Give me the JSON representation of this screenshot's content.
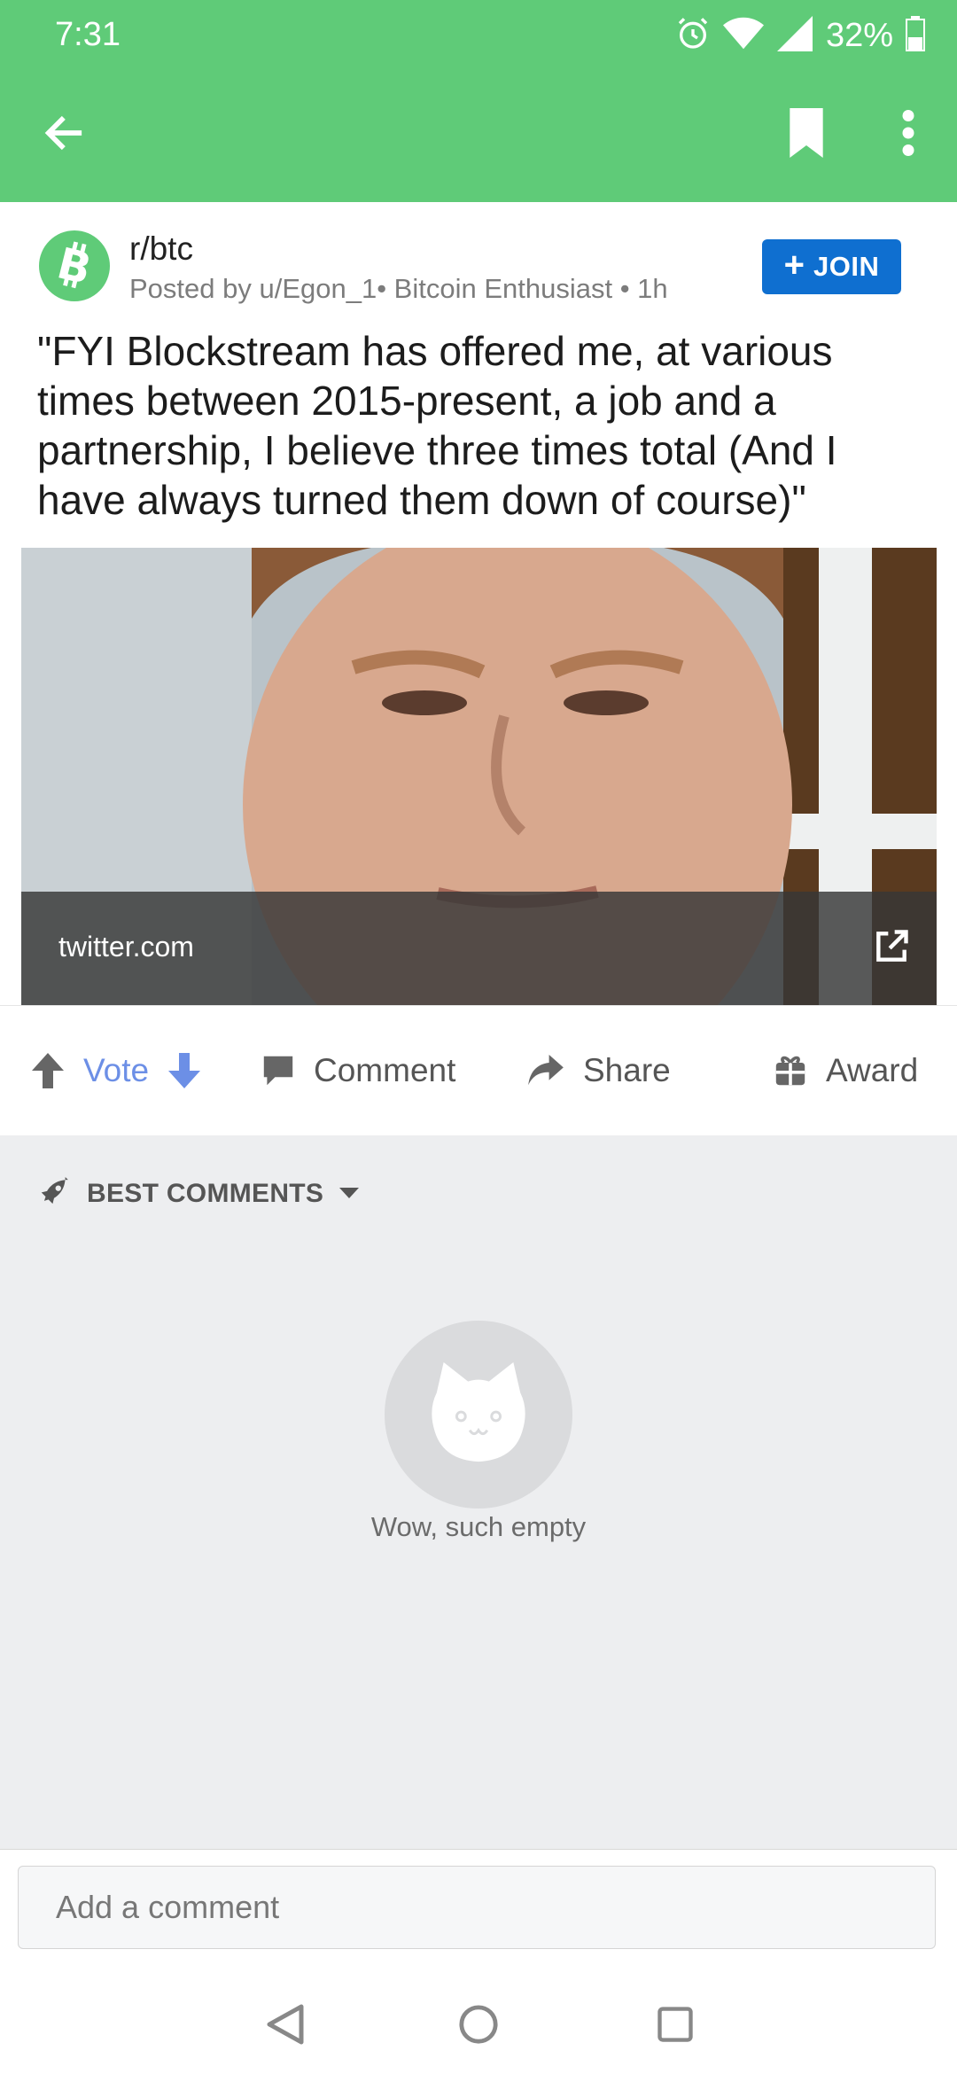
{
  "status_bar": {
    "time": "7:31",
    "battery": "32%"
  },
  "toolbar": {
    "back_icon": "arrow-left-icon",
    "bookmark_icon": "bookmark-icon",
    "more_icon": "more-vertical-icon"
  },
  "post": {
    "subreddit": "r/btc",
    "subreddit_icon": "bitcoin-icon",
    "meta": "Posted by u/Egon_1• Bitcoin Enthusiast • 1h",
    "join_label": "JOIN",
    "title": "\"FYI Blockstream has offered me, at various times between 2015-present, a job and a partnership, I believe three times total (And I have always turned them down of course)\"",
    "link_domain": "twitter.com",
    "actions": {
      "vote": "Vote",
      "comment": "Comment",
      "share": "Share",
      "award": "Award"
    }
  },
  "comments": {
    "sort_label": "BEST COMMENTS",
    "empty_text": "Wow, such empty",
    "input_placeholder": "Add a comment"
  },
  "colors": {
    "accent": "#5fcb78",
    "join_button": "#0f6fd0",
    "vote_blue": "#6c8fe6"
  }
}
